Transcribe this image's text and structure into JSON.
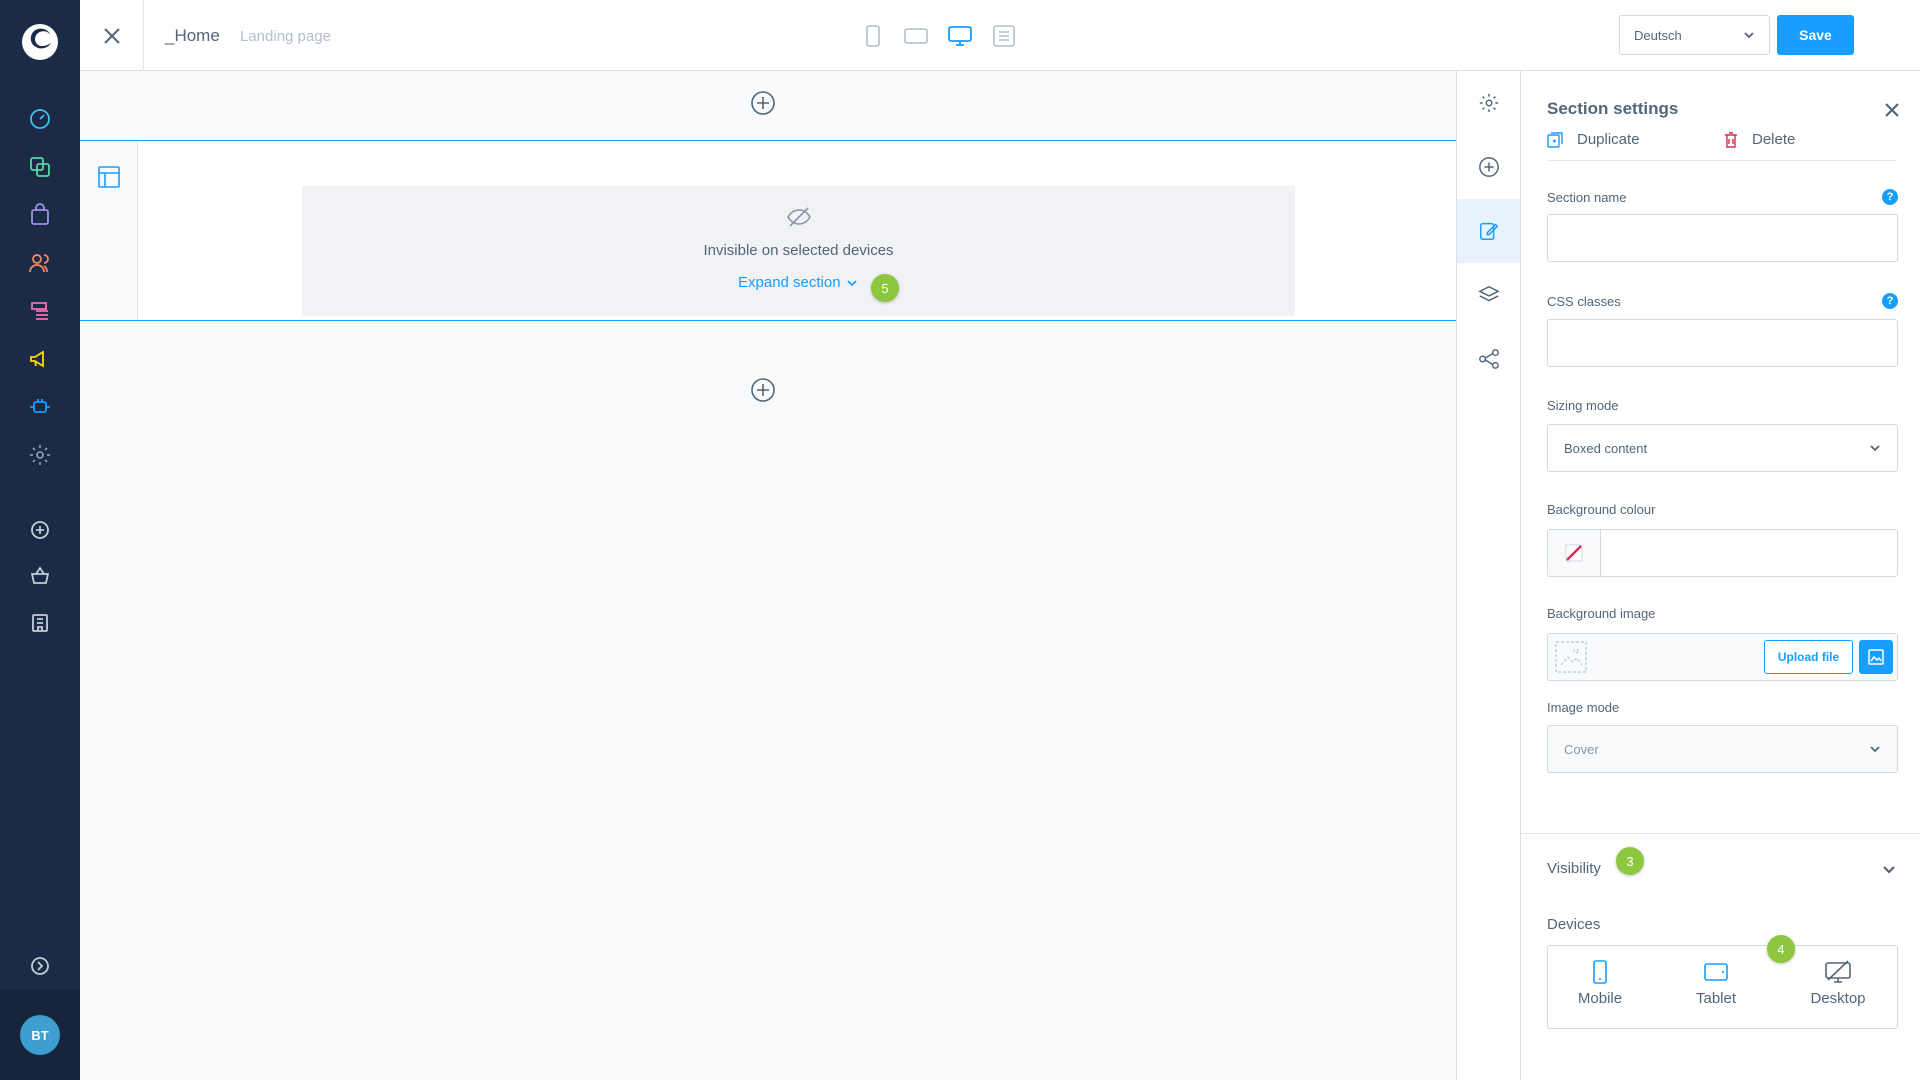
{
  "topbar": {
    "page_name": "_Home",
    "page_type": "Landing page",
    "viewports": [
      "mobile-icon",
      "tablet-icon",
      "desktop-icon",
      "list-icon"
    ],
    "active_viewport": "desktop",
    "language": "Deutsch",
    "save_label": "Save"
  },
  "nav": {
    "icons": [
      "dashboard-icon",
      "catalogues-icon",
      "orders-icon",
      "customers-icon",
      "content-icon",
      "marketing-icon",
      "extensions-icon",
      "settings-icon",
      "add-icon",
      "basket-icon",
      "store-icon",
      "expand-icon"
    ],
    "avatar": "BT"
  },
  "canvas": {
    "hidden_text": "Invisible on selected devices",
    "expand_label": "Expand section"
  },
  "markers": {
    "m3": "3",
    "m4": "4",
    "m5": "5"
  },
  "toolbar": {
    "tools": [
      "settings-icon",
      "add-block-icon",
      "edit-section-icon",
      "layers-icon",
      "share-icon"
    ],
    "active": "edit-section-icon"
  },
  "panel": {
    "title": "Section settings",
    "duplicate": "Duplicate",
    "delete": "Delete",
    "section_name_label": "Section name",
    "section_name_value": "",
    "css_classes_label": "CSS classes",
    "css_classes_value": "",
    "help": "?",
    "sizing_mode_label": "Sizing mode",
    "sizing_mode_value": "Boxed content",
    "bg_colour_label": "Background colour",
    "bg_image_label": "Background image",
    "upload_label": "Upload file",
    "image_mode_label": "Image mode",
    "image_mode_value": "Cover",
    "visibility_label": "Visibility",
    "devices_label": "Devices",
    "devices": [
      "Mobile",
      "Tablet",
      "Desktop"
    ]
  },
  "colors": {
    "accent": "#189eff",
    "nav_bg": "#1b2a45",
    "marker": "#8dc63f",
    "delete": "#de294c"
  }
}
